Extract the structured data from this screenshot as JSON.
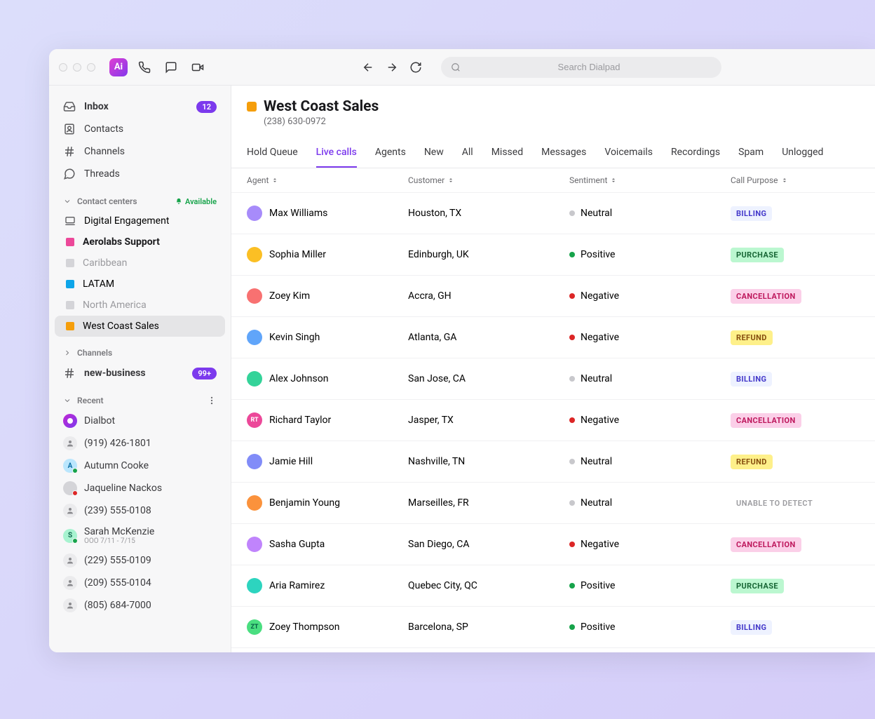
{
  "search": {
    "placeholder": "Search Dialpad"
  },
  "sidebar": {
    "top": [
      {
        "key": "inbox",
        "label": "Inbox",
        "icon": "inbox",
        "bold": true,
        "badge": "12"
      },
      {
        "key": "contacts",
        "label": "Contacts",
        "icon": "contacts"
      },
      {
        "key": "channels",
        "label": "Channels",
        "icon": "hash"
      },
      {
        "key": "threads",
        "label": "Threads",
        "icon": "threads"
      }
    ],
    "contact_centers_label": "Contact centers",
    "available_label": "Available",
    "contact_centers": [
      {
        "label": "Digital Engagement",
        "color": "",
        "type": "laptop"
      },
      {
        "label": "Aerolabs Support",
        "color": "#ec4899",
        "bold": true
      },
      {
        "label": "Caribbean",
        "color": "#d4d4d8",
        "muted": true
      },
      {
        "label": "LATAM",
        "color": "#0ea5e9"
      },
      {
        "label": "North America",
        "color": "#d4d4d8",
        "muted": true
      },
      {
        "label": "West Coast Sales",
        "color": "#f59e0b",
        "selected": true
      }
    ],
    "channels_section_label": "Channels",
    "channels": [
      {
        "label": "new-business",
        "badge": "99+",
        "bold": true
      }
    ],
    "recent_label": "Recent",
    "recent": [
      {
        "label": "Dialbot",
        "avatar": "purple",
        "initials": "",
        "icon": "bot"
      },
      {
        "label": "(919) 426-1801",
        "avatar": "person"
      },
      {
        "label": "Autumn Cooke",
        "avatar": "sky",
        "initials": "A",
        "presence": "green"
      },
      {
        "label": "Jaqueline Nackos",
        "avatar": "img",
        "presence": "red"
      },
      {
        "label": "(239) 555-0108",
        "avatar": "person"
      },
      {
        "label": "Sarah McKenzie",
        "avatar": "green",
        "initials": "S",
        "presence": "green",
        "sub": "OOO 7/11 - 7/15"
      },
      {
        "label": "(229) 555-0109",
        "avatar": "person"
      },
      {
        "label": "(209) 555-0104",
        "avatar": "person"
      },
      {
        "label": "(805) 684-7000",
        "avatar": "person"
      }
    ]
  },
  "main": {
    "title": "West Coast Sales",
    "phone": "(238) 630-0972",
    "tabs": [
      "Hold Queue",
      "Live calls",
      "Agents",
      "New",
      "All",
      "Missed",
      "Messages",
      "Voicemails",
      "Recordings",
      "Spam",
      "Unlogged"
    ],
    "active_tab": 1,
    "columns": [
      "Agent",
      "Customer",
      "Sentiment",
      "Call Purpose"
    ],
    "rows": [
      {
        "agent": "Max Williams",
        "customer": "Houston, TX",
        "sentiment": "Neutral",
        "purpose": "BILLING",
        "avatar": "img"
      },
      {
        "agent": "Sophia Miller",
        "customer": "Edinburgh, UK",
        "sentiment": "Positive",
        "purpose": "PURCHASE",
        "avatar": "img"
      },
      {
        "agent": "Zoey Kim",
        "customer": "Accra, GH",
        "sentiment": "Negative",
        "purpose": "CANCELLATION",
        "avatar": "img"
      },
      {
        "agent": "Kevin Singh",
        "customer": "Atlanta, GA",
        "sentiment": "Negative",
        "purpose": "REFUND",
        "avatar": "img"
      },
      {
        "agent": "Alex Johnson",
        "customer": "San Jose, CA",
        "sentiment": "Neutral",
        "purpose": "BILLING",
        "avatar": "img"
      },
      {
        "agent": "Richard Taylor",
        "customer": "Jasper, TX",
        "sentiment": "Negative",
        "purpose": "CANCELLATION",
        "avatar": "rt",
        "initials": "RT"
      },
      {
        "agent": "Jamie Hill",
        "customer": "Nashville, TN",
        "sentiment": "Neutral",
        "purpose": "REFUND",
        "avatar": "img"
      },
      {
        "agent": "Benjamin Young",
        "customer": "Marseilles, FR",
        "sentiment": "Neutral",
        "purpose": "UNABLE TO DETECT",
        "avatar": "img"
      },
      {
        "agent": "Sasha Gupta",
        "customer": "San Diego, CA",
        "sentiment": "Negative",
        "purpose": "CANCELLATION",
        "avatar": "img"
      },
      {
        "agent": "Aria Ramirez",
        "customer": "Quebec City, QC",
        "sentiment": "Positive",
        "purpose": "PURCHASE",
        "avatar": "img"
      },
      {
        "agent": "Zoey Thompson",
        "customer": "Barcelona, SP",
        "sentiment": "Positive",
        "purpose": "BILLING",
        "avatar": "zt",
        "initials": "ZT"
      }
    ]
  }
}
